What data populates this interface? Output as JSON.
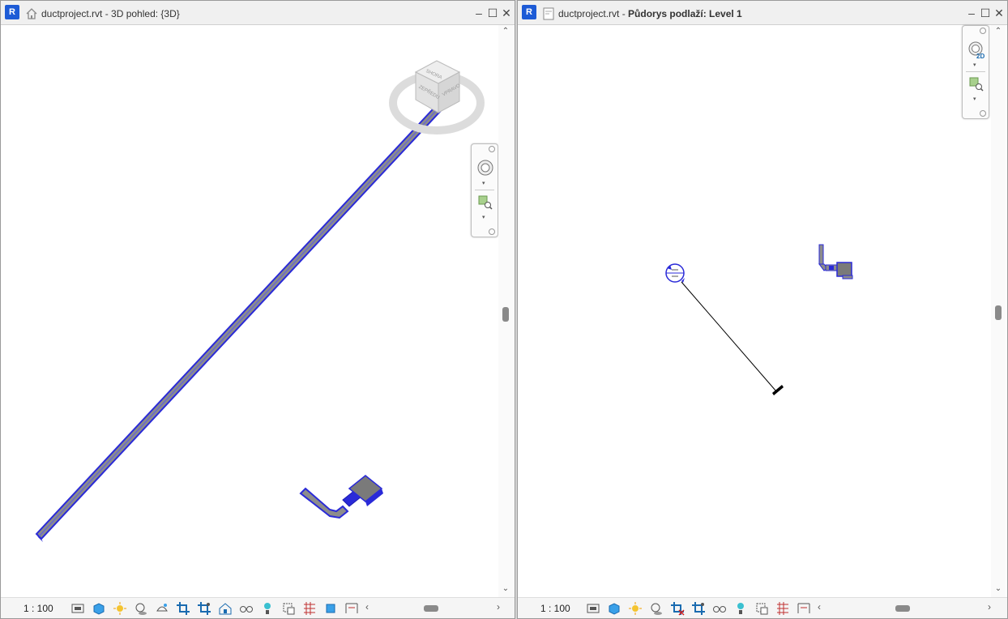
{
  "left_window": {
    "app_badge": "R",
    "view_icon": "home-icon",
    "title_prefix": "ductproject.rvt - 3D pohled: {3D}",
    "scale": "1 : 100",
    "viewcube_faces": [
      "SHORA",
      "ZEPŘEDU",
      "VPRAVO"
    ]
  },
  "right_window": {
    "app_badge": "R",
    "view_icon": "floor-plan-icon",
    "title_prefix": "ductproject.rvt - ",
    "title_bold": "Půdorys podlaží: Level 1",
    "scale": "1 : 100",
    "nav_badge": "2D"
  },
  "window_buttons": {
    "minimize": "–",
    "maximize": "☐",
    "close": "✕"
  },
  "scroll": {
    "up": "⌃",
    "down": "⌄",
    "left": "‹",
    "right": "›"
  },
  "colors": {
    "duct_blue": "#2a2ad8",
    "duct_gray": "#8c8c8c",
    "brand": "#1d5bd6"
  },
  "status_icons_left": [
    "detail-level-icon",
    "visual-style-icon",
    "sun-path-icon",
    "shadows-icon",
    "render-icon",
    "crop-view-icon",
    "show-crop-icon",
    "unlock-3d-icon",
    "temporary-hide-icon",
    "reveal-hidden-icon",
    "temporary-properties-icon",
    "worksets-icon",
    "analytical-model-icon",
    "highlight-displacement-icon",
    "constraints-icon"
  ],
  "status_icons_right": [
    "detail-level-icon",
    "visual-style-icon",
    "sun-path-icon",
    "shadows-icon",
    "crop-view-icon",
    "show-crop-icon",
    "temporary-hide-icon",
    "reveal-hidden-icon",
    "temporary-properties-icon",
    "worksets-icon",
    "constraints-icon"
  ]
}
